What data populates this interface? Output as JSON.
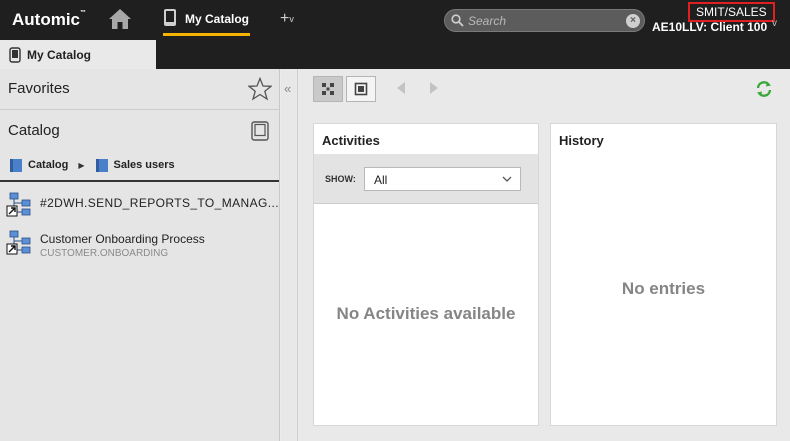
{
  "header": {
    "brand": "Automic",
    "brand_mark": "™",
    "nav_label": "My Catalog",
    "add_label": "+",
    "add_caret": "v",
    "search_placeholder": "Search",
    "search_clear": "×",
    "user": "SMIT/SALES",
    "client": "AE10LLV: Client 100"
  },
  "tab": {
    "label": "My Catalog"
  },
  "left": {
    "favorites_title": "Favorites",
    "catalog_title": "Catalog",
    "breadcrumb": [
      "Catalog",
      "Sales users"
    ],
    "items": [
      {
        "name": "#2DWH.SEND_REPORTS_TO_MANAG...",
        "sub": ""
      },
      {
        "name": "Customer Onboarding Process",
        "sub": "CUSTOMER.ONBOARDING"
      }
    ]
  },
  "main": {
    "activities": {
      "title": "Activities",
      "show_label": "SHOW:",
      "show_value": "All",
      "empty": "No Activities available"
    },
    "history": {
      "title": "History",
      "empty": "No entries"
    }
  },
  "colors": {
    "topbar": "#1f1f1f",
    "accent": "#f4b400",
    "user_border": "#e02020",
    "refresh": "#3aa83a",
    "folder": "#4a7fc9"
  },
  "icons": [
    "home-icon",
    "device-icon",
    "plus-icon",
    "search-icon",
    "clear-icon",
    "star-icon",
    "book-icon",
    "folder-icon",
    "workflow-icon",
    "collapse-icon",
    "grid-view-icon",
    "single-view-icon",
    "back-arrow-icon",
    "forward-arrow-icon",
    "refresh-icon",
    "dropdown-caret-icon"
  ]
}
